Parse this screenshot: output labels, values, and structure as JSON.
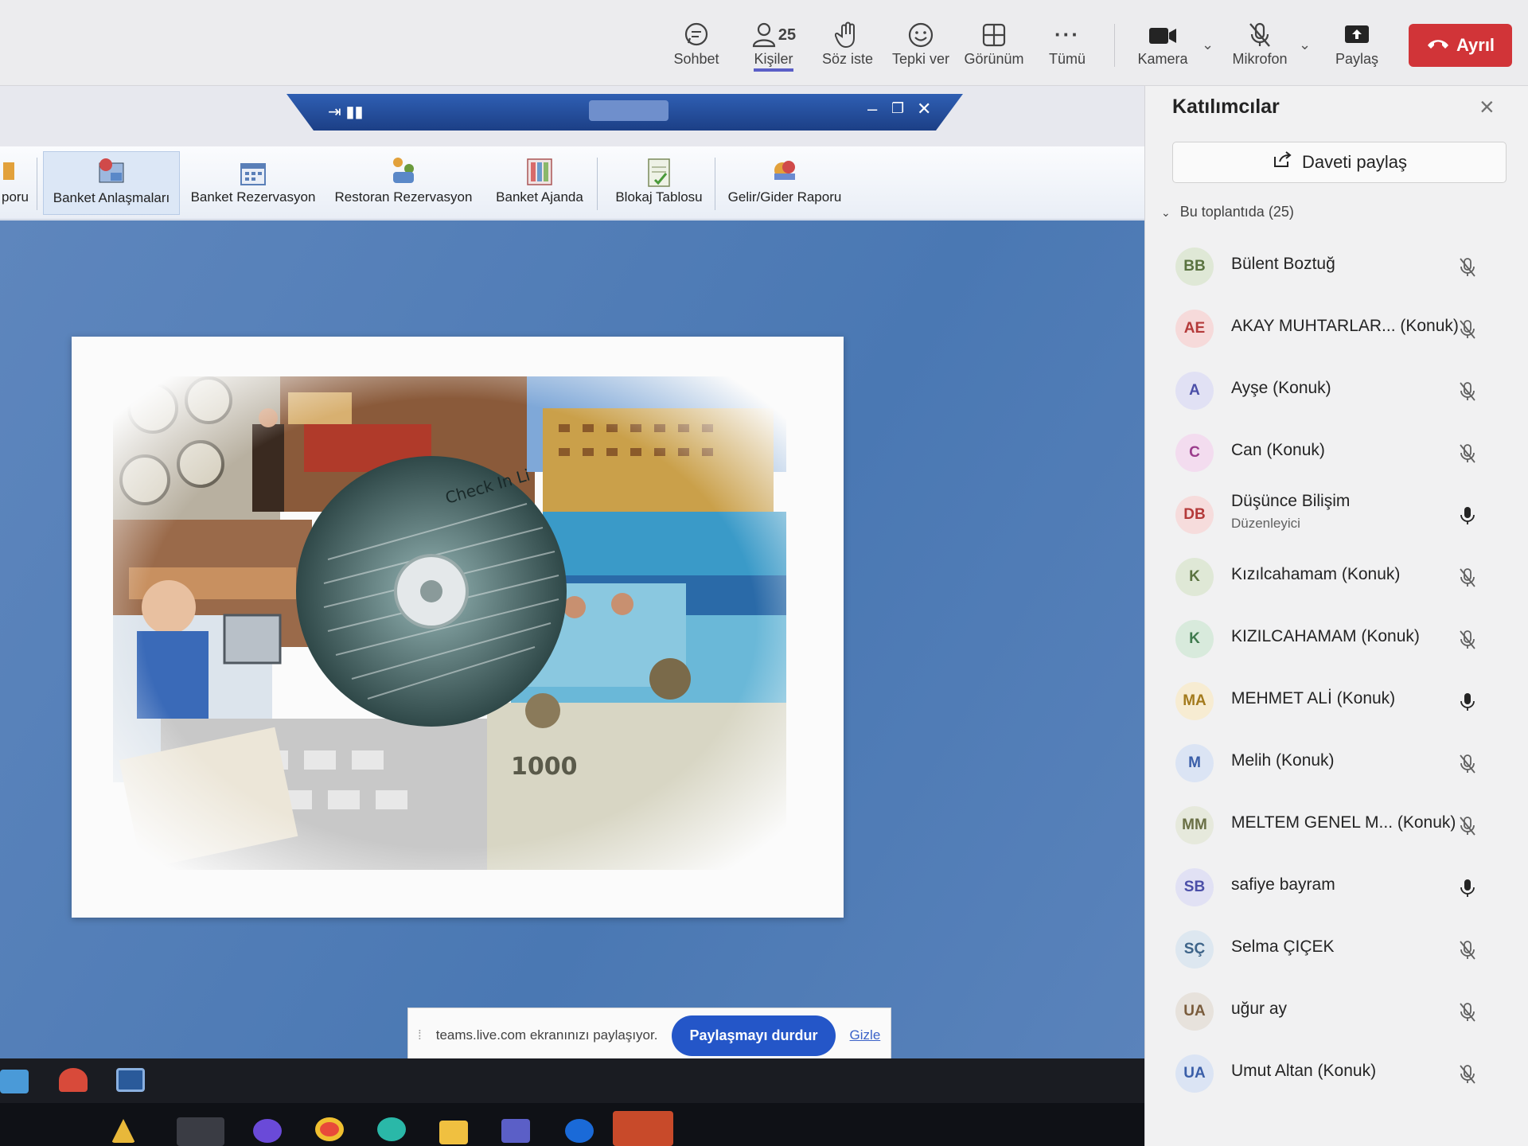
{
  "toolbar": {
    "chat_label": "Sohbet",
    "people_label": "Kişiler",
    "people_count": "25",
    "raise_hand_label": "Söz iste",
    "react_label": "Tepki ver",
    "view_label": "Görünüm",
    "more_label": "Tümü",
    "camera_label": "Kamera",
    "mic_label": "Mikrofon",
    "share_label": "Paylaş",
    "leave_label": "Ayrıl",
    "leave_color": "#d13438",
    "accent_color": "#5b5fc7"
  },
  "app_ribbon": {
    "items": [
      {
        "label": "poru",
        "icon": "report-icon"
      },
      {
        "label": "Banket Anlaşmaları",
        "icon": "agreement-icon"
      },
      {
        "label": "Banket Rezervasyon",
        "icon": "calendar-grid-icon"
      },
      {
        "label": "Restoran Rezervasyon",
        "icon": "people-icon"
      },
      {
        "label": "Banket Ajanda",
        "icon": "agenda-icon"
      },
      {
        "label": "Blokaj Tablosu",
        "icon": "clipboard-icon"
      },
      {
        "label": "Gelir/Gider Raporu",
        "icon": "money-chart-icon"
      }
    ]
  },
  "share_bar": {
    "message": "teams.live.com ekranınızı paylaşıyor.",
    "stop_label": "Paylaşmayı durdur",
    "hide_label": "Gizle"
  },
  "panel": {
    "title": "Katılımcılar",
    "invite_label": "Daveti paylaş",
    "section_label": "Bu toplantıda (25)",
    "participants": [
      {
        "initials": "BB",
        "name": "Bülent Boztuğ",
        "role": "",
        "mic": "muted",
        "bg": "#dfe8d6",
        "fg": "#5a7340"
      },
      {
        "initials": "AE",
        "name": "AKAY MUHTARLAR... (Konuk)",
        "role": "",
        "mic": "muted",
        "bg": "#f6dada",
        "fg": "#b43a3a"
      },
      {
        "initials": "A",
        "name": "Ayşe (Konuk)",
        "role": "",
        "mic": "muted",
        "bg": "#e1e1f4",
        "fg": "#4b4fa8"
      },
      {
        "initials": "C",
        "name": "Can (Konuk)",
        "role": "",
        "mic": "muted",
        "bg": "#f3dcef",
        "fg": "#9b3c8c"
      },
      {
        "initials": "DB",
        "name": "Düşünce Bilişim",
        "role": "Düzenleyici",
        "mic": "on",
        "bg": "#f6dcdc",
        "fg": "#b43a3a"
      },
      {
        "initials": "K",
        "name": "Kızılcahamam (Konuk)",
        "role": "",
        "mic": "muted",
        "bg": "#dfe8d6",
        "fg": "#5a7340"
      },
      {
        "initials": "K",
        "name": "KIZILCAHAMAM (Konuk)",
        "role": "",
        "mic": "muted",
        "bg": "#d8eadc",
        "fg": "#3f7a4e"
      },
      {
        "initials": "MA",
        "name": "MEHMET ALİ (Konuk)",
        "role": "",
        "mic": "on",
        "bg": "#f7ecd2",
        "fg": "#a37a1c"
      },
      {
        "initials": "M",
        "name": "Melih (Konuk)",
        "role": "",
        "mic": "muted",
        "bg": "#dbe4f4",
        "fg": "#3a5ea8"
      },
      {
        "initials": "MM",
        "name": "MELTEM GENEL M... (Konuk)",
        "role": "",
        "mic": "muted",
        "bg": "#e6e9dc",
        "fg": "#6a7046"
      },
      {
        "initials": "SB",
        "name": "safiye bayram",
        "role": "",
        "mic": "on",
        "bg": "#e1e1f4",
        "fg": "#4b4fa8"
      },
      {
        "initials": "SÇ",
        "name": "Selma ÇIÇEK",
        "role": "",
        "mic": "muted",
        "bg": "#dde7f0",
        "fg": "#3e6489"
      },
      {
        "initials": "UA",
        "name": "uğur ay",
        "role": "",
        "mic": "muted",
        "bg": "#e7e2dc",
        "fg": "#7a5c3c"
      },
      {
        "initials": "UA",
        "name": "Umut Altan (Konuk)",
        "role": "",
        "mic": "muted",
        "bg": "#dbe4f4",
        "fg": "#3a5ea8"
      }
    ]
  }
}
